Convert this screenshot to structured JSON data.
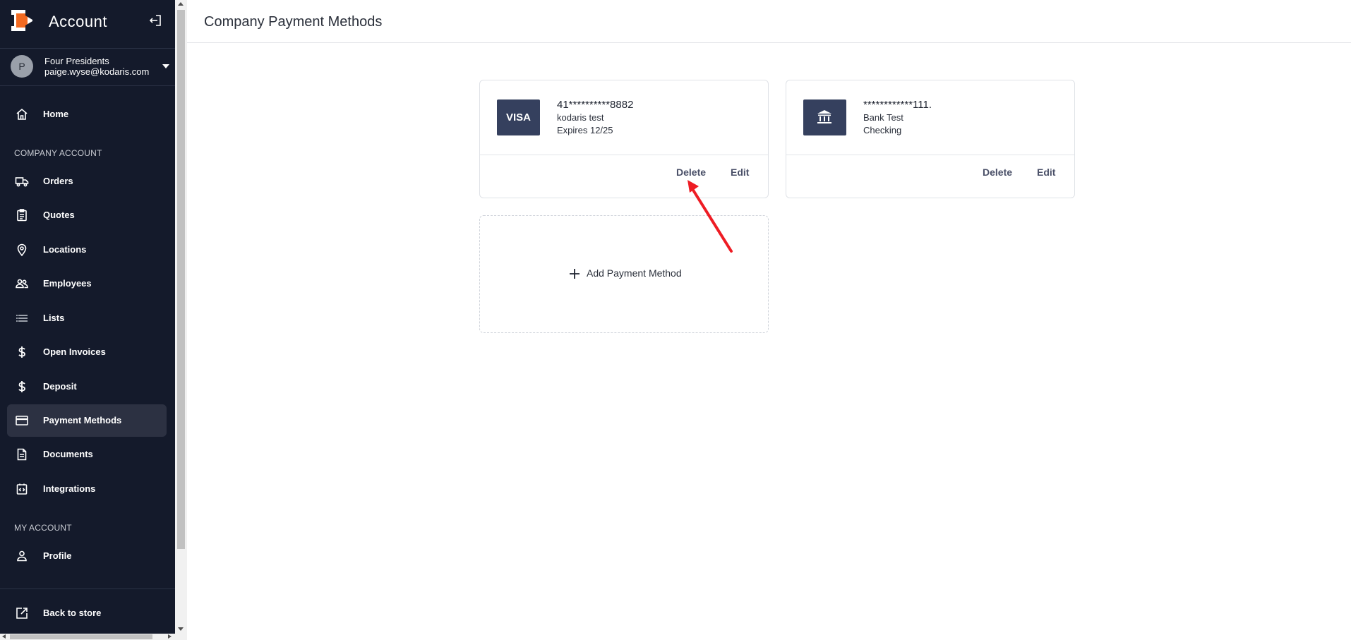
{
  "colors": {
    "sidebar_bg": "#141a2b",
    "sidebar_active": "#2c3142",
    "badge_bg": "#35405e",
    "annotation_arrow": "#ee1c24"
  },
  "sidebar": {
    "title": "Account",
    "user": {
      "initial": "P",
      "name": "Four Presidents",
      "email": "paige.wyse@kodaris.com"
    },
    "home_label": "Home",
    "company_section_label": "COMPANY ACCOUNT",
    "company_items": [
      {
        "label": "Orders",
        "icon": "truck-icon"
      },
      {
        "label": "Quotes",
        "icon": "clipboard-icon"
      },
      {
        "label": "Locations",
        "icon": "location-pin-icon"
      },
      {
        "label": "Employees",
        "icon": "people-icon"
      },
      {
        "label": "Lists",
        "icon": "list-icon"
      },
      {
        "label": "Open Invoices",
        "icon": "dollar-icon"
      },
      {
        "label": "Deposit",
        "icon": "dollar-icon"
      },
      {
        "label": "Payment Methods",
        "icon": "credit-card-icon",
        "active": true
      },
      {
        "label": "Documents",
        "icon": "document-icon"
      },
      {
        "label": "Integrations",
        "icon": "integration-icon"
      }
    ],
    "my_section_label": "MY ACCOUNT",
    "my_items": [
      {
        "label": "Profile",
        "icon": "person-icon"
      }
    ],
    "back_label": "Back to store"
  },
  "header": {
    "title": "Company Payment Methods"
  },
  "payment_methods": [
    {
      "badge": "VISA",
      "badge_icon": "visa-card-icon",
      "number": "41**********8882",
      "line2": "kodaris test",
      "line3": "Expires 12/25",
      "delete_label": "Delete",
      "edit_label": "Edit"
    },
    {
      "badge": "",
      "badge_icon": "bank-icon",
      "number": "************111.",
      "line2": "Bank Test",
      "line3": "Checking",
      "delete_label": "Delete",
      "edit_label": "Edit"
    }
  ],
  "add_method_label": "Add Payment Method"
}
